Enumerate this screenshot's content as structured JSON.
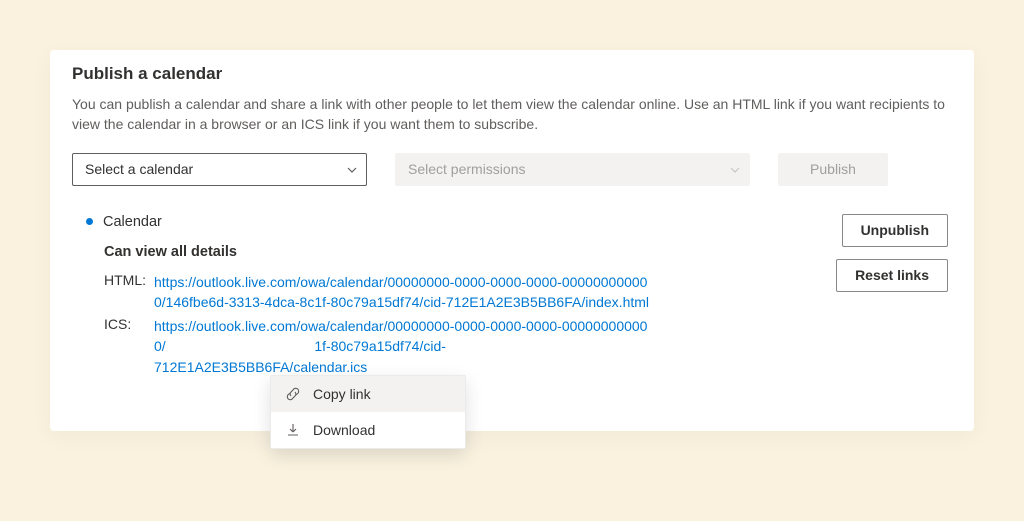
{
  "header": {
    "title": "Publish a calendar",
    "description": "You can publish a calendar and share a link with other people to let them view the calendar online. Use an HTML link if you want recipients to view the calendar in a browser or an ICS link if you want them to subscribe."
  },
  "controls": {
    "calendar_select_placeholder": "Select a calendar",
    "permission_select_placeholder": "Select permissions",
    "publish_button": "Publish"
  },
  "published": {
    "calendar_name": "Calendar",
    "permission_label": "Can view all details",
    "html_label": "HTML:",
    "html_url": "https://outlook.live.com/owa/calendar/00000000-0000-0000-0000-000000000000/146fbe6d-3313-4dca-8c1f-80c79a15df74/cid-712E1A2E3B5BB6FA/index.html",
    "ics_label": "ICS:",
    "ics_url_pre": "https://outlook.live.com/owa/calendar/00000000-0000-0000-0000-000000000000/",
    "ics_url_post": "1f-80c79a15df74/cid-",
    "ics_url_tail": "712E1A2E3B5BB6FA/calendar.ics"
  },
  "actions": {
    "unpublish": "Unpublish",
    "reset_links": "Reset links"
  },
  "context_menu": {
    "copy_link": "Copy link",
    "download": "Download"
  }
}
